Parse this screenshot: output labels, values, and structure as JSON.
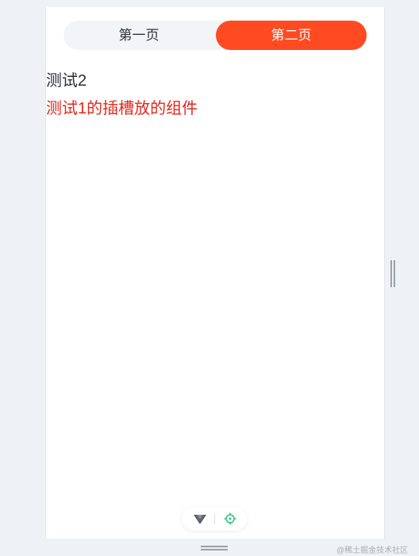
{
  "tabs": [
    {
      "label": "第一页"
    },
    {
      "label": "第二页"
    }
  ],
  "content": {
    "line1": "测试2",
    "line2": "测试1的插槽放的组件"
  },
  "colors": {
    "active_tab": "#ff4a22",
    "slot_text": "#e5261b"
  },
  "icons": {
    "devtools_left": "vue-logo-icon",
    "devtools_right": "target-icon"
  },
  "watermark": "@稀土掘金技术社区"
}
